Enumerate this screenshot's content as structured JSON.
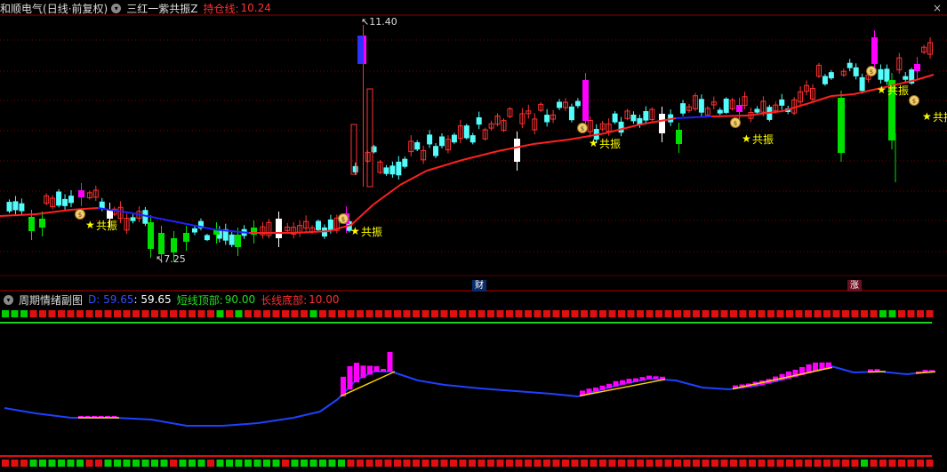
{
  "main_header": {
    "stock_name": "和顺电气",
    "period_info": "(日线·前复权)",
    "indicator_name": "三红一紫共振Z",
    "hold_line_label": "持仓线:",
    "hold_line_value": "10.24"
  },
  "sub_header": {
    "indicator_name": "周期情绪副图",
    "d_label": "D: 59.65",
    "d_value": ": 59.65",
    "short_top_label": "短线顶部:",
    "short_top_value": "90.00",
    "long_bottom_label": "长线底部:",
    "long_bottom_value": "10.00"
  },
  "price_markers": {
    "high": "11.40",
    "low": "7.25"
  },
  "event_tags": {
    "finance": "财",
    "limit_up": "涨"
  },
  "signal_label": "共振",
  "colors": {
    "up_candle": "#ff3232",
    "down_candle": "#54fcfc",
    "green_candle": "#00e000",
    "magenta_candle": "#ff00ff",
    "white_candle": "#ffffff",
    "hold_line_red": "#ff2020",
    "hold_line_blue": "#2020ff",
    "grid": "#7a0000",
    "star": "#ffff00"
  },
  "icons": {
    "collapse": "chevron-down-icon",
    "money_bag": "money-bag-icon",
    "star": "star-icon",
    "close": "close-icon"
  }
}
